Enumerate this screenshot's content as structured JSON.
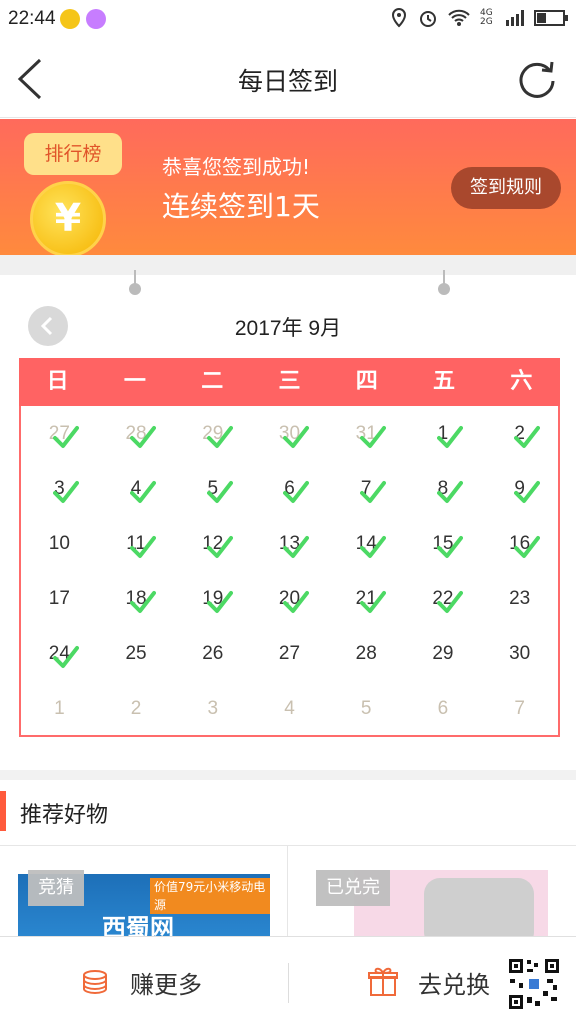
{
  "status_bar": {
    "time": "22:44",
    "network": "4G 2G",
    "icons": [
      "location-icon",
      "alarm-icon",
      "wifi-icon",
      "signal-icon",
      "battery-icon"
    ]
  },
  "nav": {
    "title": "每日签到",
    "back_icon": "chevron-left-icon",
    "refresh_icon": "refresh-icon"
  },
  "banner": {
    "rank_label": "排行榜",
    "coin_symbol": "¥",
    "message": "恭喜您签到成功!",
    "streak": "连续签到1天",
    "rules_button": "签到规则"
  },
  "calendar": {
    "month_label": "2017年 9月",
    "weekdays": [
      "日",
      "一",
      "二",
      "三",
      "四",
      "五",
      "六"
    ],
    "check_color": "#4cd964",
    "days": [
      {
        "label": "27",
        "muted": true,
        "checked": true
      },
      {
        "label": "28",
        "muted": true,
        "checked": true
      },
      {
        "label": "29",
        "muted": true,
        "checked": true
      },
      {
        "label": "30",
        "muted": true,
        "checked": true
      },
      {
        "label": "31",
        "muted": true,
        "checked": true
      },
      {
        "label": "1",
        "muted": false,
        "checked": true
      },
      {
        "label": "2",
        "muted": false,
        "checked": true
      },
      {
        "label": "3",
        "muted": false,
        "checked": true
      },
      {
        "label": "4",
        "muted": false,
        "checked": true
      },
      {
        "label": "5",
        "muted": false,
        "checked": true
      },
      {
        "label": "6",
        "muted": false,
        "checked": true
      },
      {
        "label": "7",
        "muted": false,
        "checked": true
      },
      {
        "label": "8",
        "muted": false,
        "checked": true
      },
      {
        "label": "9",
        "muted": false,
        "checked": true
      },
      {
        "label": "10",
        "muted": false,
        "checked": false
      },
      {
        "label": "11",
        "muted": false,
        "checked": true
      },
      {
        "label": "12",
        "muted": false,
        "checked": true
      },
      {
        "label": "13",
        "muted": false,
        "checked": true
      },
      {
        "label": "14",
        "muted": false,
        "checked": true
      },
      {
        "label": "15",
        "muted": false,
        "checked": true
      },
      {
        "label": "16",
        "muted": false,
        "checked": true
      },
      {
        "label": "17",
        "muted": false,
        "checked": false
      },
      {
        "label": "18",
        "muted": false,
        "checked": true
      },
      {
        "label": "19",
        "muted": false,
        "checked": true
      },
      {
        "label": "20",
        "muted": false,
        "checked": true
      },
      {
        "label": "21",
        "muted": false,
        "checked": true
      },
      {
        "label": "22",
        "muted": false,
        "checked": true
      },
      {
        "label": "23",
        "muted": false,
        "checked": false
      },
      {
        "label": "24",
        "muted": false,
        "checked": true
      },
      {
        "label": "25",
        "muted": false,
        "checked": false
      },
      {
        "label": "26",
        "muted": false,
        "checked": false
      },
      {
        "label": "27",
        "muted": false,
        "checked": false
      },
      {
        "label": "28",
        "muted": false,
        "checked": false
      },
      {
        "label": "29",
        "muted": false,
        "checked": false
      },
      {
        "label": "30",
        "muted": false,
        "checked": false
      },
      {
        "label": "1",
        "muted": true,
        "checked": false
      },
      {
        "label": "2",
        "muted": true,
        "checked": false
      },
      {
        "label": "3",
        "muted": true,
        "checked": false
      },
      {
        "label": "4",
        "muted": true,
        "checked": false
      },
      {
        "label": "5",
        "muted": true,
        "checked": false
      },
      {
        "label": "6",
        "muted": true,
        "checked": false
      },
      {
        "label": "7",
        "muted": true,
        "checked": false
      }
    ]
  },
  "recommend": {
    "title": "推荐好物",
    "products": [
      {
        "tag": "竞猜",
        "banner_text": "价值79元小米移动电源",
        "logo_text": "西蜀网"
      },
      {
        "tag": "已兑完"
      }
    ]
  },
  "bottom_bar": {
    "earn_label": "赚更多",
    "redeem_label": "去兑换"
  },
  "colors": {
    "accent": "#ff6363",
    "banner_start": "#ff6a5c",
    "banner_end": "#ff8a3d",
    "rules_button": "#a9482d"
  }
}
